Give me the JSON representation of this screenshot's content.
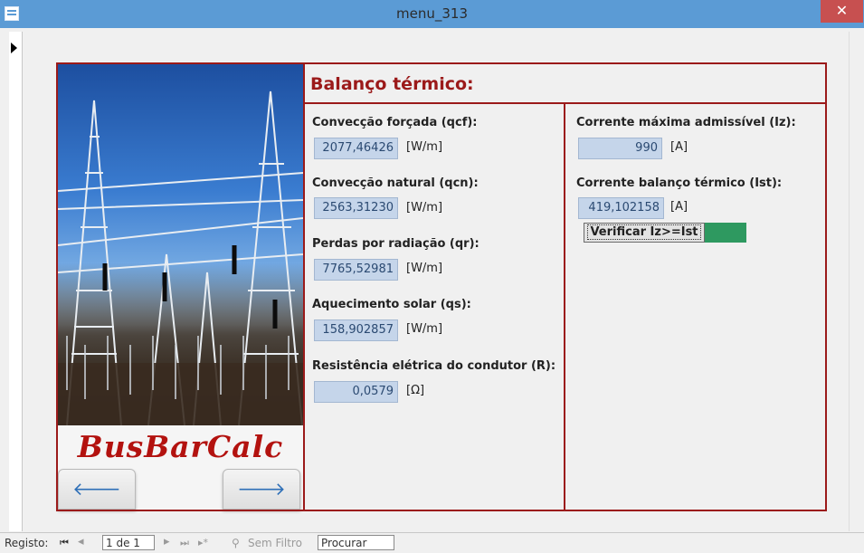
{
  "window": {
    "title": "menu_313"
  },
  "header": {
    "title": "Balanço térmico:"
  },
  "logo": {
    "text": "BusBarCalc"
  },
  "nav": {
    "prev": "🡐",
    "next": "🡒"
  },
  "left_panel": {
    "fields": [
      {
        "label": "Convecção forçada (qcf):",
        "value": "2077,46426",
        "unit": "[W/m]"
      },
      {
        "label": "Convecção natural (qcn):",
        "value": "2563,31230",
        "unit": "[W/m]"
      },
      {
        "label": "Perdas por radiação (qr):",
        "value": "7765,52981",
        "unit": "[W/m]"
      },
      {
        "label": "Aquecimento solar (qs):",
        "value": "158,902857",
        "unit": "[W/m]"
      },
      {
        "label": "Resistência elétrica do condutor (R):",
        "value": "0,0579",
        "unit": "[Ω]"
      }
    ]
  },
  "right_panel": {
    "fields": [
      {
        "label": "Corrente máxima admissível (Iz):",
        "value": "990",
        "unit": "[A]"
      },
      {
        "label": "Corrente balanço térmico (Ist):",
        "value": "419,102158",
        "unit": "[A]"
      }
    ],
    "verify_label": "Verificar Iz>=Ist",
    "status_color": "#2e9960"
  },
  "navigation_bar": {
    "record_label": "Registo:",
    "first": "⏮",
    "prev": "◂",
    "record_value": "1 de 1",
    "next": "▸",
    "last": "⏭",
    "new": "▸*",
    "filter_label": "Sem Filtro",
    "search_placeholder": "Procurar"
  },
  "colors": {
    "accent": "#9b1a1a",
    "titlebar": "#5b9bd5",
    "field_bg": "#c5d5ea"
  }
}
